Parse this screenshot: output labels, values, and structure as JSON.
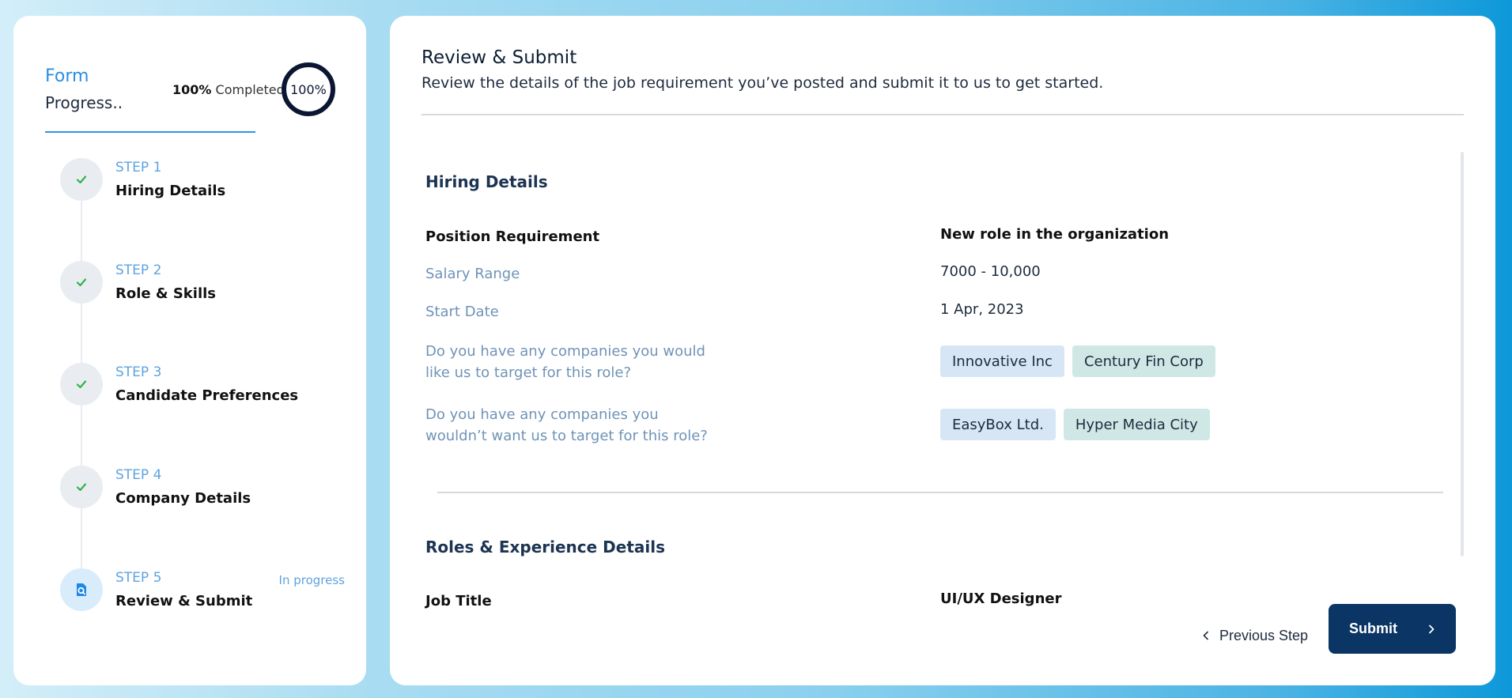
{
  "sidebar": {
    "form_label": "Form",
    "progress_label": "Progress..",
    "completed_pct": "100%",
    "completed_text": "Completed",
    "ring_label": "100%",
    "progress_value": 1.0,
    "steps": [
      {
        "num": "STEP 1",
        "title": "Hiring Details",
        "status": "",
        "icon": "check-icon"
      },
      {
        "num": "STEP 2",
        "title": "Role & Skills",
        "status": "",
        "icon": "check-icon"
      },
      {
        "num": "STEP 3",
        "title": "Candidate Preferences",
        "status": "",
        "icon": "check-icon"
      },
      {
        "num": "STEP 4",
        "title": "Company Details",
        "status": "",
        "icon": "check-icon"
      },
      {
        "num": "STEP 5",
        "title": "Review & Submit",
        "status": "In progress",
        "icon": "document-search-icon"
      }
    ]
  },
  "main": {
    "title": "Review & Submit",
    "subtitle": "Review the details of the job requirement you’ve posted and submit it to us to get started.",
    "hiring": {
      "title": "Hiring Details",
      "position_label": "Position Requirement",
      "position_value": "New role in the organization",
      "salary_label": "Salary Range",
      "salary_value": "7000 - 10,000",
      "start_label": "Start Date",
      "start_value": "1 Apr, 2023",
      "target_label_1": "Do you have any companies you would",
      "target_label_2": "like us to target for this role?",
      "target_tags": [
        "Innovative Inc",
        "Century Fin Corp"
      ],
      "avoid_label_1": "Do you have any companies you",
      "avoid_label_2": "wouldn’t want us to target for this role?",
      "avoid_tags": [
        "EasyBox Ltd.",
        "Hyper Media City"
      ]
    },
    "roles": {
      "title": "Roles & Experience Details",
      "job_title_label": "Job Title",
      "job_title_value": "UI/UX Designer"
    },
    "prev_label": "Previous Step",
    "submit_label": "Submit"
  },
  "colors": {
    "accent": "#2b8fdf",
    "check": "#2fb34a",
    "submit_bg": "#0a3564",
    "ring": "#0b1632"
  }
}
